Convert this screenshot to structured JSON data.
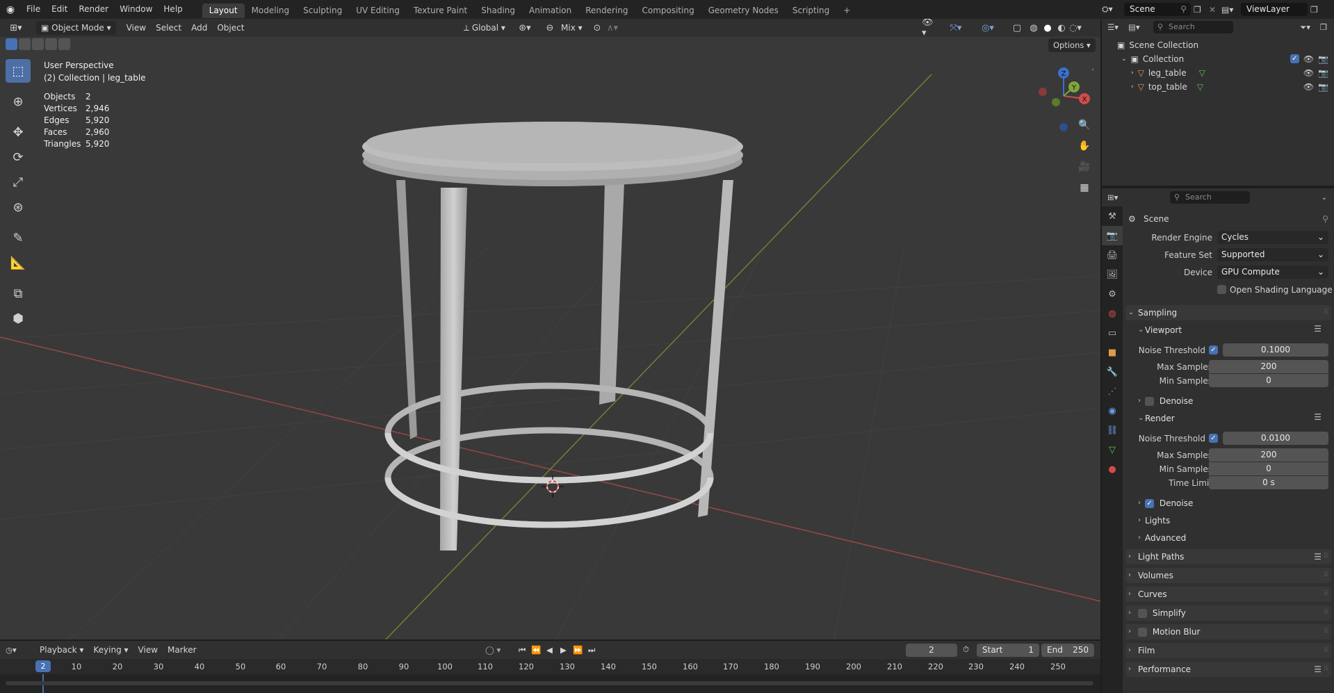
{
  "topbar": {
    "menus": [
      "File",
      "Edit",
      "Render",
      "Window",
      "Help"
    ],
    "workspaces": [
      "Layout",
      "Modeling",
      "Sculpting",
      "UV Editing",
      "Texture Paint",
      "Shading",
      "Animation",
      "Rendering",
      "Compositing",
      "Geometry Nodes",
      "Scripting"
    ],
    "add_tab": "+",
    "scene": "Scene",
    "view_layer": "ViewLayer"
  },
  "viewport_header": {
    "mode": "Object Mode",
    "menus": [
      "View",
      "Select",
      "Add",
      "Object"
    ],
    "transform_orientation": "Global",
    "snap_mode": "Mix",
    "options": "Options"
  },
  "viewport": {
    "view_name": "User Perspective",
    "collection_path": "(2) Collection | leg_table",
    "stats": [
      {
        "key": "Objects",
        "value": "2"
      },
      {
        "key": "Vertices",
        "value": "2,946"
      },
      {
        "key": "Edges",
        "value": "5,920"
      },
      {
        "key": "Faces",
        "value": "2,960"
      },
      {
        "key": "Triangles",
        "value": "5,920"
      }
    ],
    "gizmo_axes": {
      "x": "X",
      "y": "Y",
      "z": "Z"
    }
  },
  "outliner": {
    "search_placeholder": "Search",
    "root": "Scene Collection",
    "collection": "Collection",
    "objects": [
      "leg_table",
      "top_table"
    ]
  },
  "properties": {
    "search_placeholder": "Search",
    "context": "Scene",
    "render_engine_label": "Render Engine",
    "render_engine": "Cycles",
    "feature_set_label": "Feature Set",
    "feature_set": "Supported",
    "device_label": "Device",
    "device": "GPU Compute",
    "osl_label": "Open Shading Language",
    "sampling": "Sampling",
    "viewport_sub": "Viewport",
    "noise_threshold_label": "Noise Threshold",
    "viewport_noise_threshold": "0.1000",
    "max_samples_label": "Max Samples",
    "viewport_max_samples": "200",
    "min_samples_label": "Min Samples",
    "viewport_min_samples": "0",
    "denoise_label": "Denoise",
    "render_sub": "Render",
    "render_noise_threshold": "0.0100",
    "render_max_samples": "200",
    "render_min_samples": "0",
    "time_limit_label": "Time Limit",
    "time_limit": "0 s",
    "lights": "Lights",
    "advanced": "Advanced",
    "panels": [
      "Light Paths",
      "Volumes",
      "Curves",
      "Simplify",
      "Motion Blur",
      "Film",
      "Performance"
    ]
  },
  "timeline": {
    "menus": [
      "Playback",
      "Keying",
      "View",
      "Marker"
    ],
    "current_frame": "2",
    "start_label": "Start",
    "start": "1",
    "end_label": "End",
    "end": "250",
    "ticks": [
      "10",
      "20",
      "30",
      "40",
      "50",
      "60",
      "70",
      "80",
      "90",
      "100",
      "110",
      "120",
      "130",
      "140",
      "150",
      "160",
      "170",
      "180",
      "190",
      "200",
      "210",
      "220",
      "230",
      "240",
      "250"
    ],
    "playhead": "2"
  }
}
